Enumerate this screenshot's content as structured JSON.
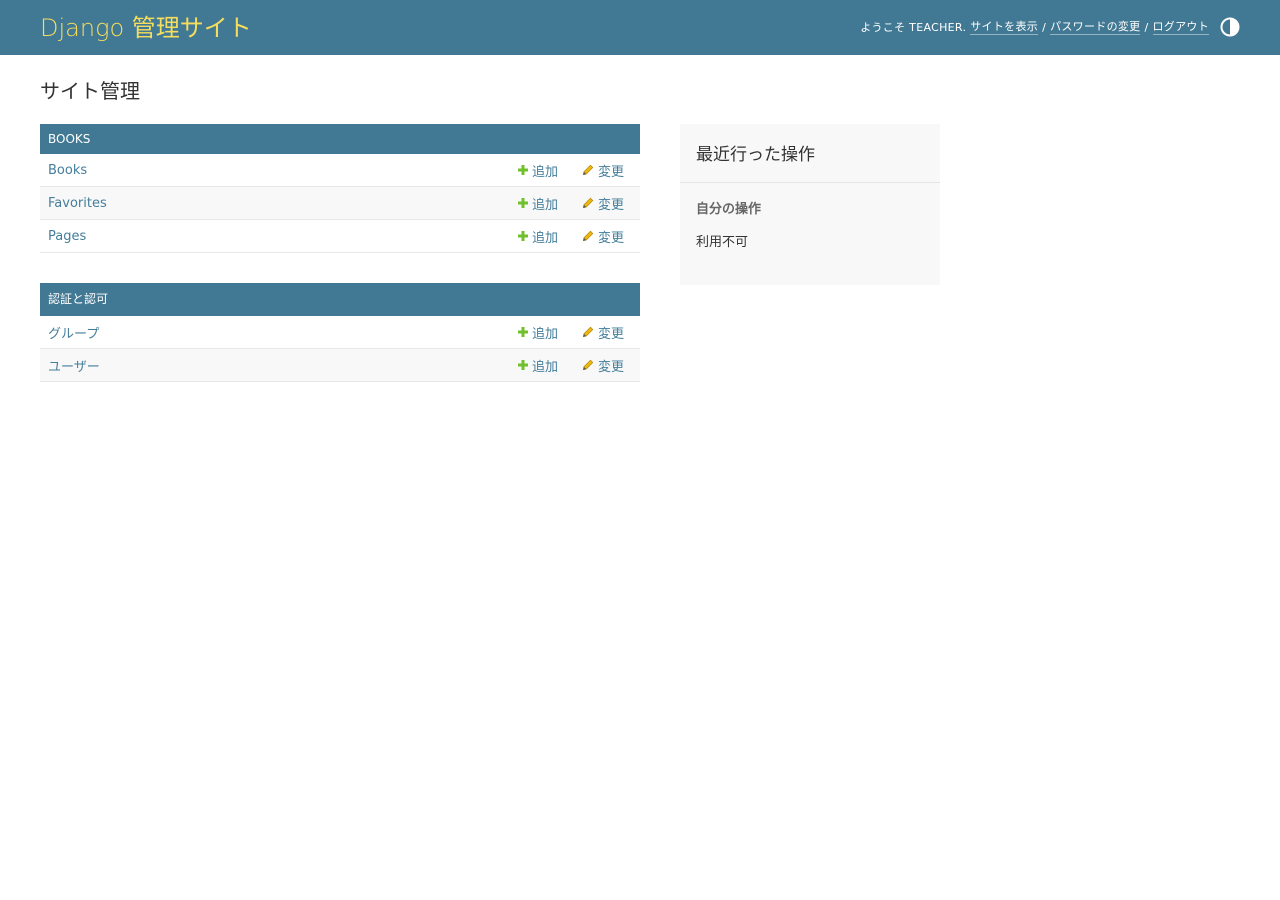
{
  "header": {
    "site_title": "Django 管理サイト",
    "welcome": "ようこそ TEACHER.",
    "view_site": "サイトを表示",
    "change_password": "パスワードの変更",
    "logout": "ログアウト",
    "separator": "/",
    "theme_icon": "theme-toggle-icon"
  },
  "page": {
    "title": "サイト管理"
  },
  "apps": [
    {
      "name": "BOOKS",
      "models": [
        {
          "name": "Books",
          "add": "追加",
          "change": "変更"
        },
        {
          "name": "Favorites",
          "add": "追加",
          "change": "変更"
        },
        {
          "name": "Pages",
          "add": "追加",
          "change": "変更"
        }
      ]
    },
    {
      "name": "認証と認可",
      "models": [
        {
          "name": "グループ",
          "add": "追加",
          "change": "変更"
        },
        {
          "name": "ユーザー",
          "add": "追加",
          "change": "変更"
        }
      ]
    }
  ],
  "recent_actions": {
    "title": "最近行った操作",
    "my_actions": "自分の操作",
    "none_available": "利用不可"
  },
  "colors": {
    "header_bg": "#417893",
    "branding": "#f5dd5d",
    "link": "#447e9b",
    "add_icon": "#70bf2b",
    "change_icon": "#efb80b"
  }
}
